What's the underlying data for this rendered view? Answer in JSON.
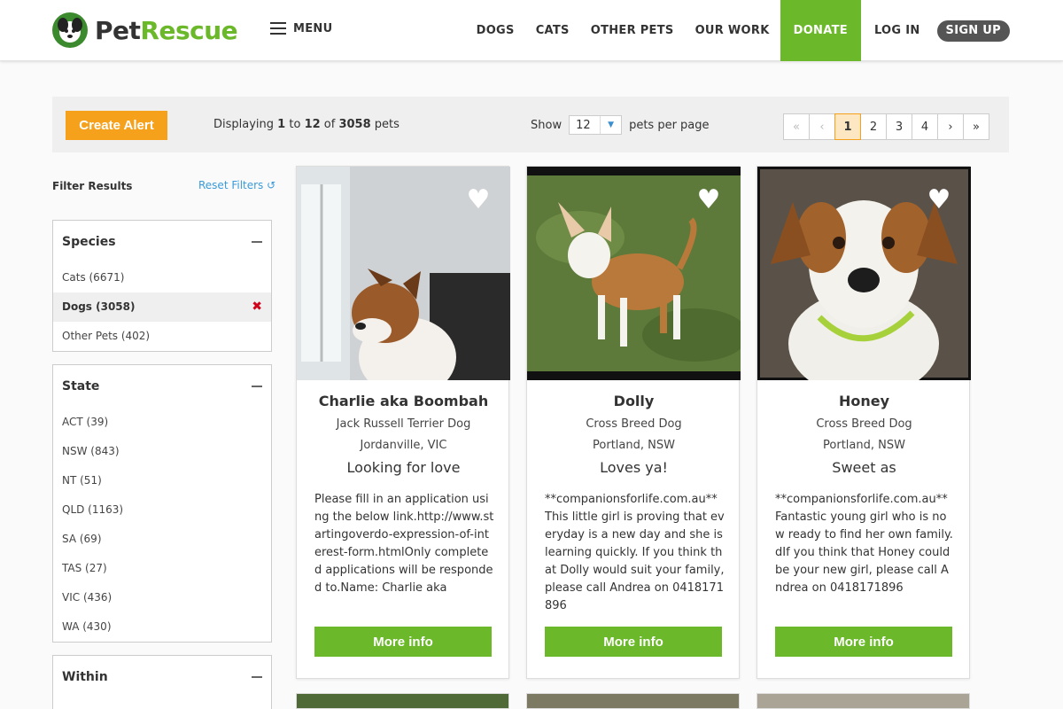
{
  "header": {
    "logo_pet": "Pet",
    "logo_rescue": "Rescue",
    "menu_label": "MENU",
    "nav": [
      "DOGS",
      "CATS",
      "OTHER PETS",
      "OUR WORK"
    ],
    "donate": "DONATE",
    "login": "LOG IN",
    "signup": "SIGN UP"
  },
  "toolbar": {
    "create_alert": "Create Alert",
    "displaying_prefix": "Displaying",
    "range_start": "1",
    "to": "to",
    "range_end": "12",
    "of": "of",
    "total": "3058",
    "pets": "pets",
    "show": "Show",
    "per_page_value": "12",
    "per_page_suffix": "pets per page",
    "pagination": {
      "first": "«",
      "prev": "‹",
      "pages": [
        "1",
        "2",
        "3",
        "4"
      ],
      "next": "›",
      "last": "»",
      "current": "1"
    }
  },
  "sidebar": {
    "title": "Filter Results",
    "reset": "Reset Filters",
    "species": {
      "heading": "Species",
      "items": [
        "Cats (6671)",
        "Dogs (3058)",
        "Other Pets (402)"
      ],
      "selected": "Dogs (3058)"
    },
    "state": {
      "heading": "State",
      "items": [
        "ACT (39)",
        "NSW (843)",
        "NT (51)",
        "QLD (1163)",
        "SA (69)",
        "TAS (27)",
        "VIC (436)",
        "WA (430)"
      ]
    },
    "within": {
      "heading": "Within"
    }
  },
  "pets": [
    {
      "name": "Charlie aka Boombah",
      "breed": "Jack Russell Terrier Dog",
      "location": "Jordanville, VIC",
      "tagline": "Looking for love",
      "description": "Please fill in an application using the below link.http://www.startingoverdo-expression-of-interest-form.htmlOnly completed applications will be responded to.Name: Charlie aka",
      "button": "More info"
    },
    {
      "name": "Dolly",
      "breed": "Cross Breed Dog",
      "location": "Portland, NSW",
      "tagline": "Loves ya!",
      "description": "**companionsforlife.com.au** This little girl is proving that everyday is a new day and she is learning quickly. If you think that Dolly would suit your family, please call Andrea on 0418171896",
      "button": "More info"
    },
    {
      "name": "Honey",
      "breed": "Cross Breed Dog",
      "location": "Portland, NSW",
      "tagline": "Sweet as",
      "description": "**companionsforlife.com.au** Fantastic young girl who is now ready to find her own family. dIf you think that Honey could be your new girl, please call Andrea on 0418171896",
      "button": "More info"
    }
  ],
  "colors": {
    "brand_green": "#6bb82a",
    "alert_orange": "#f6a11c",
    "link_blue": "#3a9bd8",
    "remove_red": "#d0021b"
  }
}
